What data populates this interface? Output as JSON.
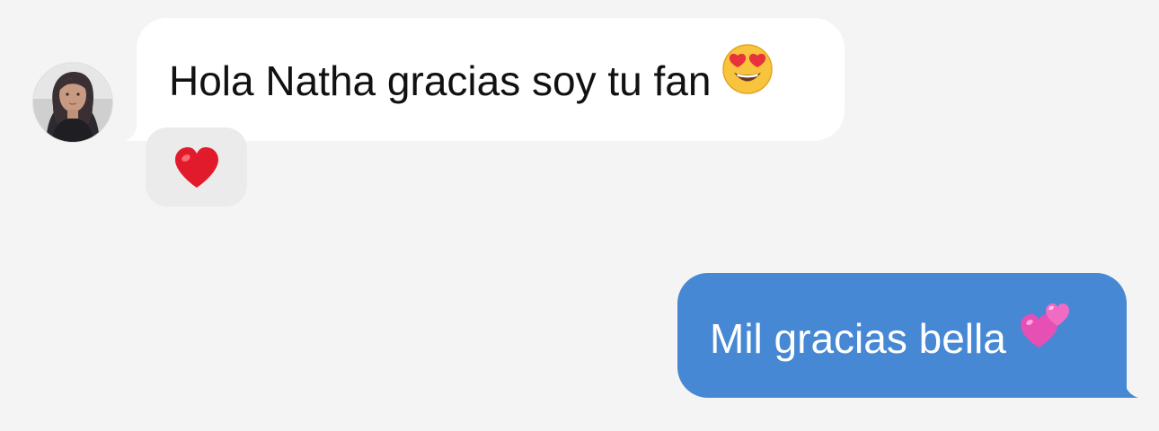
{
  "thread": {
    "incoming": {
      "sender_avatar": "avatar-woman-photo",
      "text": "Hola Natha gracias soy tu fan",
      "emoji": "smiling-face-with-heart-eyes",
      "reaction": "red-heart"
    },
    "outgoing": {
      "text": "Mil gracias bella",
      "emoji": "two-hearts"
    }
  },
  "colors": {
    "background": "#f4f4f4",
    "incoming_bubble": "#ffffff",
    "outgoing_bubble": "#4688d4",
    "reaction_bubble": "#ebebeb"
  }
}
